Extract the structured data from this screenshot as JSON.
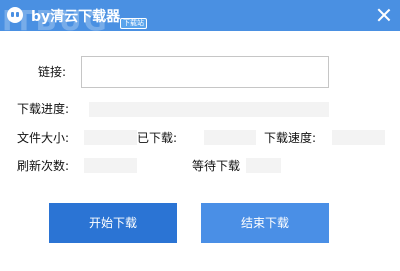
{
  "window": {
    "title": "by清云下载器",
    "badge": "下载站",
    "watermark": "ITBUG",
    "brand_color": "#4a90e2"
  },
  "form": {
    "link_label": "链接:",
    "link_value": "",
    "progress_label": "下载进度:",
    "progress_value": "",
    "file_size_label": "文件大小:",
    "file_size_value": "",
    "downloaded_label": "已下载:",
    "downloaded_value": "",
    "speed_label": "下载速度:",
    "speed_value": "",
    "refresh_label": "刷新次数:",
    "refresh_value": "",
    "waiting_label": "等待下载",
    "waiting_value": ""
  },
  "buttons": {
    "start_label": "开始下载",
    "stop_label": "结束下载"
  },
  "icons": {
    "app": "app-logo-icon",
    "close": "close-icon"
  }
}
